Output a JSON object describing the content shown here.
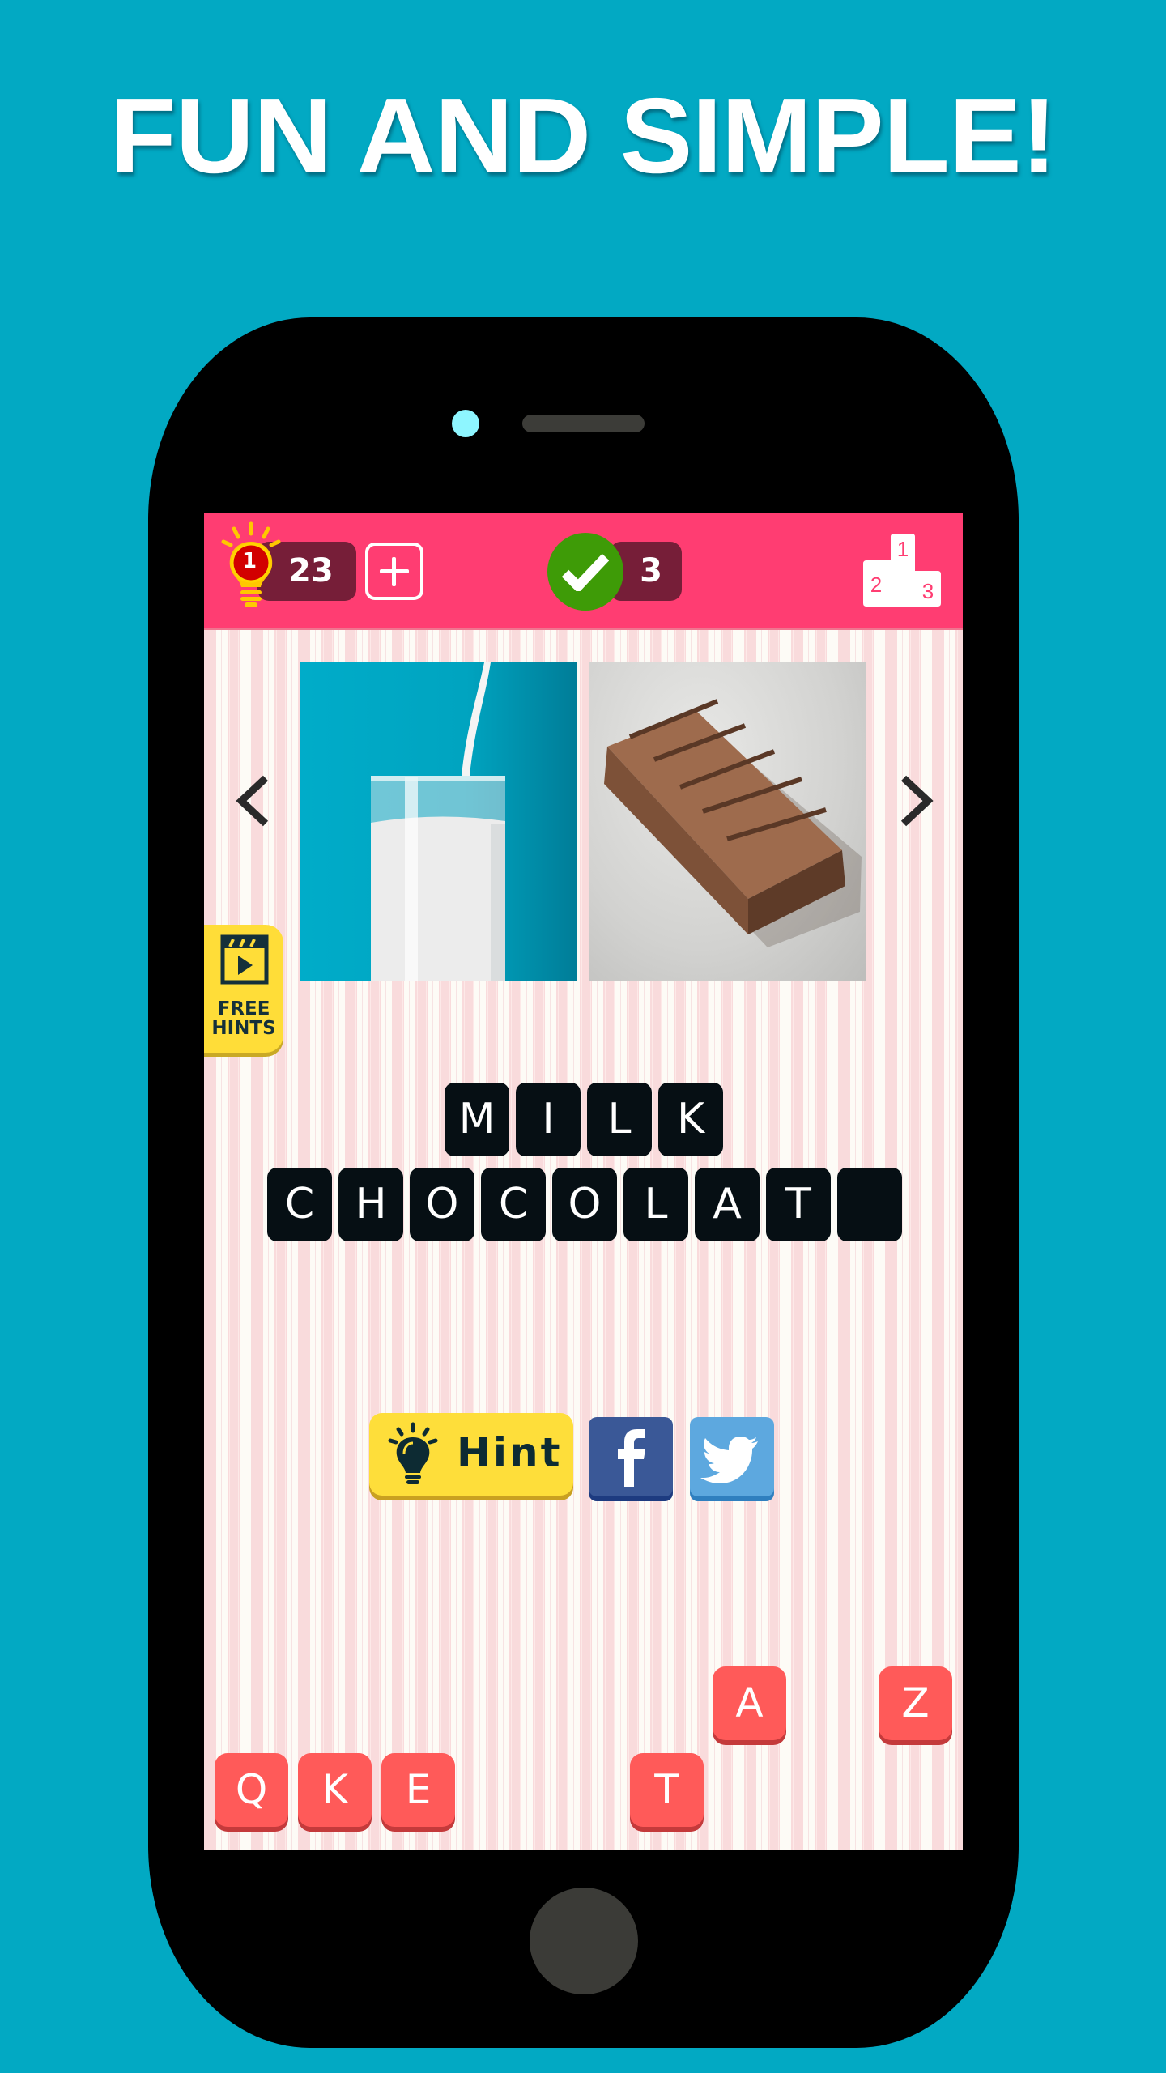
{
  "headline": "FUN AND SIMPLE!",
  "topbar": {
    "hint_level_badge": "1",
    "hints_count": "23",
    "add_hints_icon": "plus-icon",
    "solved_count": "3",
    "solved_icon": "checkmark-icon",
    "leaderboard_icon": "podium-icon",
    "podium_ranks": [
      "1",
      "2",
      "3"
    ]
  },
  "puzzle": {
    "images": [
      {
        "subject": "glass of milk"
      },
      {
        "subject": "chocolate bar"
      }
    ],
    "prev_icon": "chevron-left-icon",
    "next_icon": "chevron-right-icon",
    "free_hints": {
      "line1": "FREE",
      "line2": "HINTS",
      "icon": "video-clapper-icon"
    }
  },
  "answer": {
    "word1": [
      "M",
      "I",
      "L",
      "K"
    ],
    "word2": [
      "C",
      "H",
      "O",
      "C",
      "O",
      "L",
      "A",
      "T",
      ""
    ]
  },
  "actions": {
    "hint_label": "Hint",
    "facebook_icon": "facebook-icon",
    "twitter_icon": "twitter-icon"
  },
  "letter_keys": [
    {
      "letter": "A",
      "row": "top"
    },
    {
      "letter": "Z",
      "row": "top"
    },
    {
      "letter": "Q",
      "row": "bottom"
    },
    {
      "letter": "K",
      "row": "bottom"
    },
    {
      "letter": "E",
      "row": "bottom"
    },
    {
      "letter": "T",
      "row": "bottom"
    }
  ],
  "colors": {
    "background": "#02a9c3",
    "topbar": "#ff3d72",
    "pill": "#761e38",
    "check_green": "#3e9b07",
    "tile": "#060f14",
    "key": "#ff5a59",
    "hint_yellow": "#fede3a",
    "facebook": "#3a5897",
    "twitter": "#5da8df"
  }
}
